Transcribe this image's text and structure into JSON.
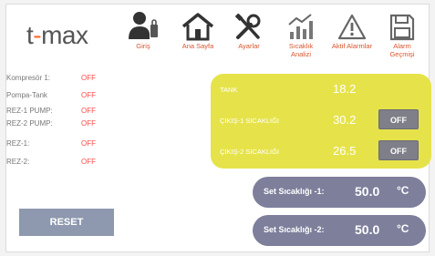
{
  "brand": {
    "logo_left": "t",
    "logo_dash": "-",
    "logo_right": "max"
  },
  "toolbar": {
    "items": [
      {
        "label": "Giriş",
        "icon": "login-icon"
      },
      {
        "label": "Ana Sayfa",
        "icon": "home-icon"
      },
      {
        "label": "Ayarlar",
        "icon": "settings-tools-icon"
      },
      {
        "label": "Sıcaklık Analizi",
        "icon": "chart-icon"
      },
      {
        "label": "Aktif Alarmlar",
        "icon": "warning-icon"
      },
      {
        "label": "Alarm Geçmişi",
        "icon": "save-icon"
      }
    ]
  },
  "status": [
    {
      "label": "Kompresör 1:",
      "state": "OFF"
    },
    {
      "label": "Pompa-Tank",
      "state": "OFF"
    },
    {
      "label": "REZ-1 PUMP:",
      "state": "OFF"
    },
    {
      "label": "REZ-2 PUMP:",
      "state": "OFF"
    },
    {
      "label": "REZ-1:",
      "state": "OFF"
    },
    {
      "label": "REZ-2:",
      "state": "OFF"
    }
  ],
  "temps": {
    "tank_label": "TANK",
    "tank_value": "18.2",
    "out1_label": "ÇIKIŞ-1 SICAKLIĞI",
    "out1_value": "30.2",
    "out1_button": "OFF",
    "out2_label": "ÇIKIŞ-2 SICAKLIĞI",
    "out2_value": "26.5",
    "out2_button": "OFF"
  },
  "setpoints": [
    {
      "label": "Set Sıcaklığı -1:",
      "value": "50.0",
      "unit": "°C"
    },
    {
      "label": "Set Sıcaklığı -2:",
      "value": "50.0",
      "unit": "°C"
    }
  ],
  "actions": {
    "reset_label": "RESET"
  },
  "colors": {
    "accent_orange": "#d8552e",
    "status_off": "#ff4a4a",
    "panel_yellow": "#e6e34a",
    "pill": "#7d7f9b",
    "button_gray": "#7f7f8a"
  }
}
